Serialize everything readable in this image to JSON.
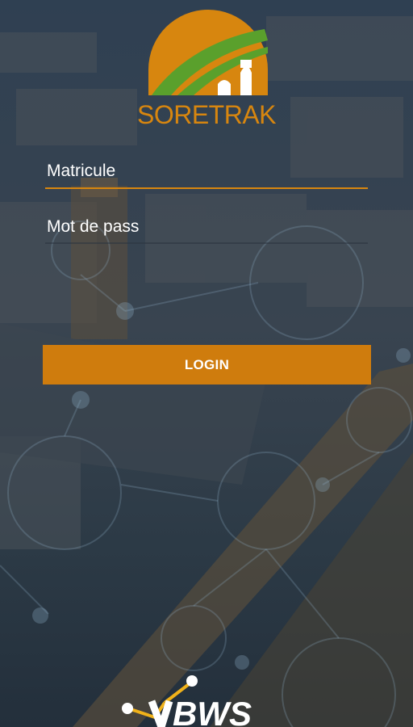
{
  "brand": {
    "name": "SORETRAK",
    "color": "#d7860f"
  },
  "form": {
    "matricule_placeholder": "Matricule",
    "password_placeholder": "Mot de pass",
    "login_label": "LOGIN"
  },
  "footer": {
    "company": "BWS"
  }
}
